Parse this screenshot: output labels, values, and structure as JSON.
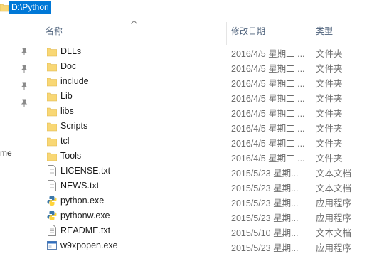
{
  "address": {
    "path": "D:\\Python"
  },
  "nav": {
    "partial_label": "me"
  },
  "columns": {
    "name": "名称",
    "date": "修改日期",
    "type": "类型"
  },
  "files": [
    {
      "name": "DLLs",
      "date": "2016/4/5 星期二 ...",
      "type": "文件夹",
      "icon": "folder-icon"
    },
    {
      "name": "Doc",
      "date": "2016/4/5 星期二 ...",
      "type": "文件夹",
      "icon": "folder-icon"
    },
    {
      "name": "include",
      "date": "2016/4/5 星期二 ...",
      "type": "文件夹",
      "icon": "folder-icon"
    },
    {
      "name": "Lib",
      "date": "2016/4/5 星期二 ...",
      "type": "文件夹",
      "icon": "folder-icon"
    },
    {
      "name": "libs",
      "date": "2016/4/5 星期二 ...",
      "type": "文件夹",
      "icon": "folder-icon"
    },
    {
      "name": "Scripts",
      "date": "2016/4/5 星期二 ...",
      "type": "文件夹",
      "icon": "folder-icon"
    },
    {
      "name": "tcl",
      "date": "2016/4/5 星期二 ...",
      "type": "文件夹",
      "icon": "folder-icon"
    },
    {
      "name": "Tools",
      "date": "2016/4/5 星期二 ...",
      "type": "文件夹",
      "icon": "folder-icon"
    },
    {
      "name": "LICENSE.txt",
      "date": "2015/5/23 星期...",
      "type": "文本文档",
      "icon": "text-file-icon"
    },
    {
      "name": "NEWS.txt",
      "date": "2015/5/23 星期...",
      "type": "文本文档",
      "icon": "text-file-icon"
    },
    {
      "name": "python.exe",
      "date": "2015/5/23 星期...",
      "type": "应用程序",
      "icon": "python-icon"
    },
    {
      "name": "pythonw.exe",
      "date": "2015/5/23 星期...",
      "type": "应用程序",
      "icon": "python-icon"
    },
    {
      "name": "README.txt",
      "date": "2015/5/10 星期...",
      "type": "文本文档",
      "icon": "text-file-icon"
    },
    {
      "name": "w9xpopen.exe",
      "date": "2015/5/23 星期...",
      "type": "应用程序",
      "icon": "exe-window-icon"
    }
  ],
  "colors": {
    "selection": "#0078d7",
    "header_text": "#4c607a",
    "folder": "#f8d775"
  }
}
